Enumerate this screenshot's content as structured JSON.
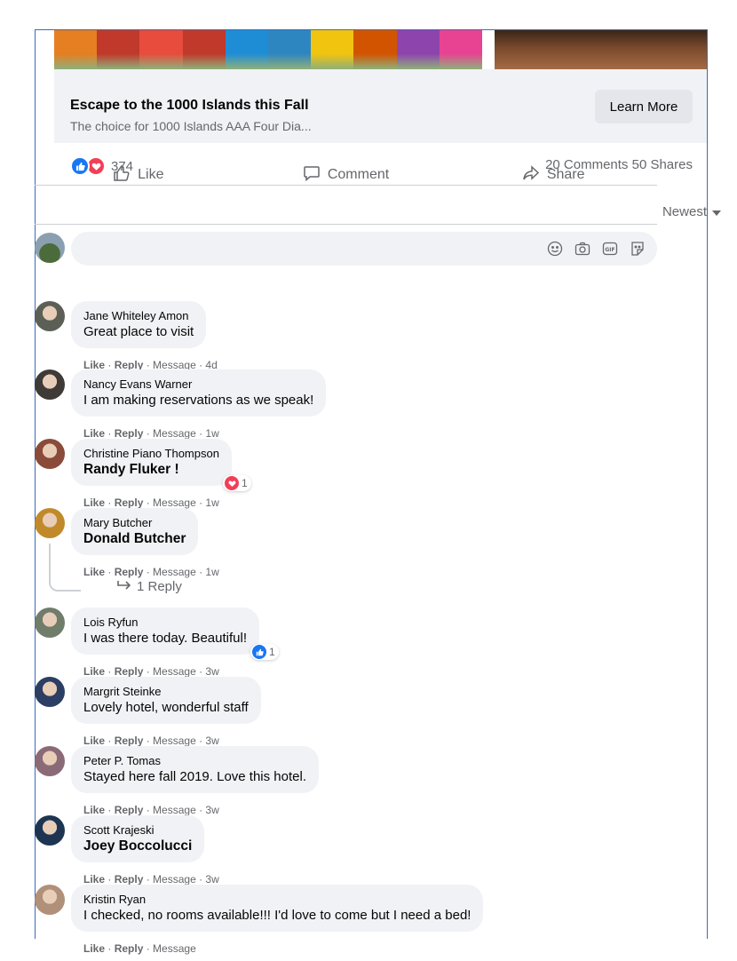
{
  "hero": {
    "chair_colors": [
      "#e67e22",
      "#c0392b",
      "#e74c3c",
      "#c0392b",
      "#1f8dd6",
      "#2e86c1",
      "#f1c40f",
      "#d35400",
      "#8e44ad",
      "#e84393"
    ]
  },
  "ad": {
    "title": "Escape to the 1000 Islands this Fall",
    "description": "The choice for 1000 Islands AAA Four Dia...",
    "cta": "Learn More"
  },
  "stats": {
    "reaction_count": "374",
    "comments": "20 Comments",
    "shares": "50 Shares"
  },
  "actions": {
    "like": "Like",
    "comment": "Comment",
    "share": "Share"
  },
  "sort": {
    "label": "Newest"
  },
  "composer": {
    "placeholder": ""
  },
  "colors": {
    "like_blue": "#1877f2",
    "love_red": "#f33e58",
    "bubble_bg": "#f0f2f5",
    "meta_grey": "#65676b"
  },
  "comments": [
    {
      "name": "Jane Whiteley Amon",
      "text": "Great place to visit",
      "bold": false,
      "like": "Like",
      "reply": "Reply",
      "message": "Message",
      "time": "4d",
      "avatar_color": "#5b5f55"
    },
    {
      "name": "Nancy Evans Warner",
      "text": "I am making reservations as we speak!",
      "bold": false,
      "like": "Like",
      "reply": "Reply",
      "message": "Message",
      "time": "1w",
      "avatar_color": "#3e3a37"
    },
    {
      "name": "Christine Piano Thompson",
      "text": "Randy Fluker !",
      "bold": true,
      "like": "Like",
      "reply": "Reply",
      "message": "Message",
      "time": "1w",
      "avatar_color": "#8a4b3a",
      "reaction": {
        "icon": "love-icon",
        "count": "1"
      }
    },
    {
      "name": "Mary Butcher",
      "text": "Donald Butcher",
      "bold": true,
      "like": "Like",
      "reply": "Reply",
      "message": "Message",
      "time": "1w",
      "avatar_color": "#c08a2b",
      "replies_label": "1 Reply"
    },
    {
      "name": "Lois Ryfun",
      "text": "I was there today. Beautiful!",
      "bold": false,
      "like": "Like",
      "reply": "Reply",
      "message": "Message",
      "time": "3w",
      "avatar_color": "#6f7d6a",
      "reaction": {
        "icon": "like-icon",
        "count": "1"
      }
    },
    {
      "name": "Margrit Steinke",
      "text": "Lovely hotel, wonderful staff",
      "bold": false,
      "like": "Like",
      "reply": "Reply",
      "message": "Message",
      "time": "3w",
      "avatar_color": "#2c3e63"
    },
    {
      "name": "Peter P. Tomas",
      "text": "Stayed here fall 2019. Love this hotel.",
      "bold": false,
      "like": "Like",
      "reply": "Reply",
      "message": "Message",
      "time": "3w",
      "avatar_color": "#8b6a78"
    },
    {
      "name": "Scott Krajeski",
      "text": "Joey Boccolucci",
      "bold": true,
      "like": "Like",
      "reply": "Reply",
      "message": "Message",
      "time": "3w",
      "avatar_color": "#1d3552"
    },
    {
      "name": "Kristin Ryan",
      "text": "I checked, no rooms available!!! I'd love to come but I need a bed!",
      "bold": false,
      "like": "Like",
      "reply": "Reply",
      "message": "Message",
      "time": "",
      "avatar_color": "#b09078"
    }
  ]
}
